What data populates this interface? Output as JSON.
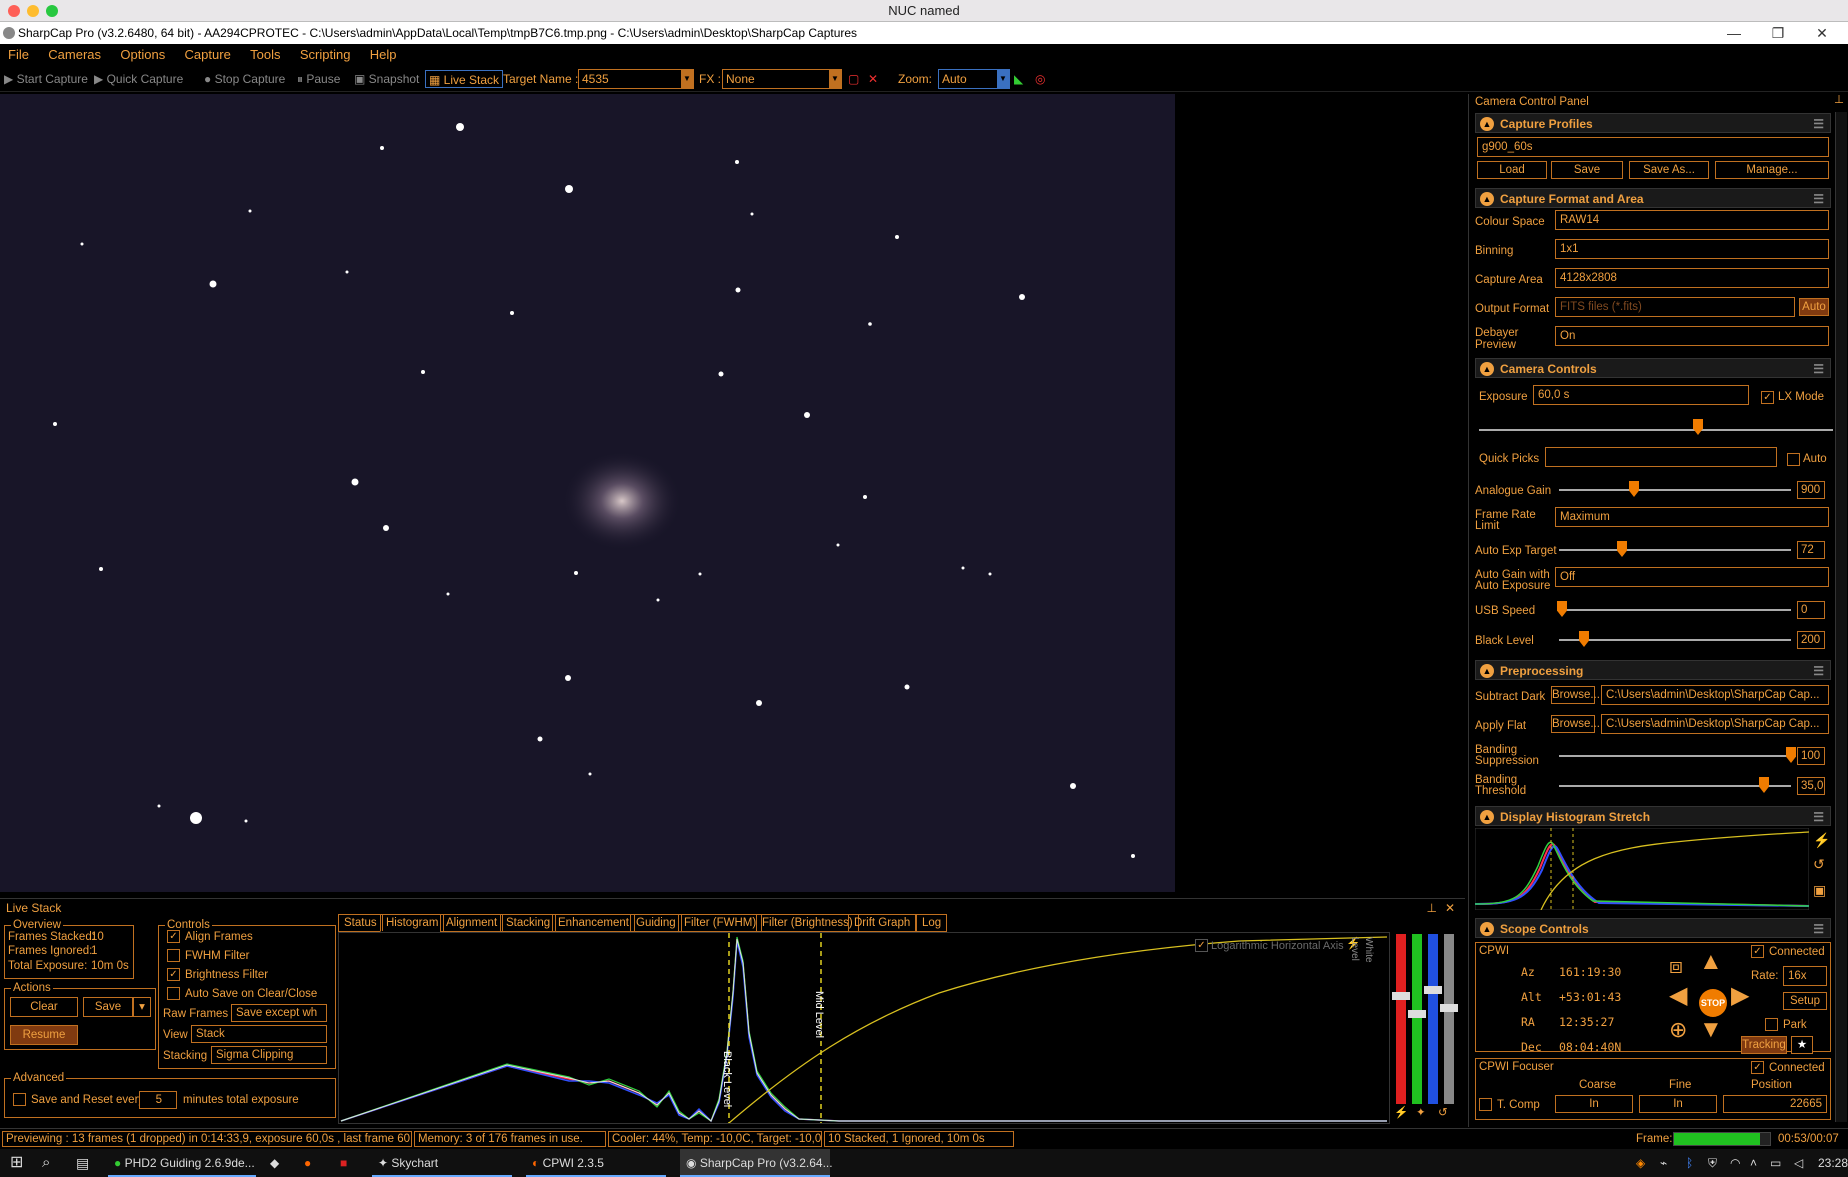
{
  "mac_title": "NUC named",
  "window_title": "SharpCap Pro (v3.2.6480, 64 bit) - AA294CPROTEC - C:\\Users\\admin\\AppData\\Local\\Temp\\tmpB7C6.tmp.png - C:\\Users\\admin\\Desktop\\SharpCap Captures",
  "menu": [
    "File",
    "Cameras",
    "Options",
    "Capture",
    "Tools",
    "Scripting",
    "Help"
  ],
  "toolbar": {
    "start_capture": "Start Capture",
    "quick_capture": "Quick Capture",
    "stop_capture": "Stop Capture",
    "pause": "Pause",
    "snapshot": "Snapshot",
    "live_stack": "Live Stack",
    "target_name_label": "Target Name :",
    "target_name_value": "4535",
    "fx_label": "FX :",
    "fx_value": "None",
    "zoom_label": "Zoom:",
    "zoom_value": "Auto"
  },
  "ccp": {
    "title": "Camera Control Panel",
    "capture_profiles": {
      "title": "Capture Profiles",
      "profile": "g900_60s",
      "load": "Load",
      "save": "Save",
      "save_as": "Save As...",
      "manage": "Manage..."
    },
    "format": {
      "title": "Capture Format and Area",
      "colour_space_label": "Colour Space",
      "colour_space": "RAW14",
      "binning_label": "Binning",
      "binning": "1x1",
      "capture_area_label": "Capture Area",
      "capture_area": "4128x2808",
      "output_format_label": "Output Format",
      "output_format": "FITS files (*.fits)",
      "auto": "Auto",
      "debayer_label_1": "Debayer",
      "debayer_label_2": "Preview",
      "debayer": "On"
    },
    "camera_controls": {
      "title": "Camera Controls",
      "exposure_label": "Exposure",
      "exposure": "60,0 s",
      "lx_mode": "LX Mode",
      "quick_picks_label": "Quick Picks",
      "auto": "Auto",
      "analogue_gain_label": "Analogue Gain",
      "analogue_gain": "900",
      "frame_rate_label_1": "Frame Rate",
      "frame_rate_label_2": "Limit",
      "frame_rate": "Maximum",
      "auto_exp_target_label": "Auto Exp Target",
      "auto_exp_target": "72",
      "auto_gain_label_1": "Auto Gain with",
      "auto_gain_label_2": "Auto Exposure",
      "auto_gain": "Off",
      "usb_speed_label": "USB Speed",
      "usb_speed": "0",
      "black_level_label": "Black Level",
      "black_level": "200"
    },
    "preprocessing": {
      "title": "Preprocessing",
      "subtract_dark_label": "Subtract Dark",
      "browse": "Browse...",
      "dark_path": "C:\\Users\\admin\\Desktop\\SharpCap Cap...",
      "apply_flat_label": "Apply Flat",
      "flat_path": "C:\\Users\\admin\\Desktop\\SharpCap Cap...",
      "banding_supp_label_1": "Banding",
      "banding_supp_label_2": "Suppression",
      "banding_supp": "100",
      "banding_thr_label_1": "Banding",
      "banding_thr_label_2": "Threshold",
      "banding_thr": "35,0"
    },
    "histogram_stretch": {
      "title": "Display Histogram Stretch"
    },
    "scope": {
      "title": "Scope Controls",
      "name": "CPWI",
      "connected": "Connected",
      "az_label": "Az",
      "az": "161:19:30",
      "alt_label": "Alt",
      "alt": "+53:01:43",
      "ra_label": "RA",
      "ra": "12:35:27",
      "dec_label": "Dec",
      "dec": "08:04:40N",
      "rate_label": "Rate:",
      "rate": "16x",
      "setup": "Setup",
      "park": "Park",
      "tracking": "Tracking",
      "stop": "STOP",
      "focuser": "CPWI Focuser",
      "focuser_connected": "Connected",
      "coarse": "Coarse",
      "fine": "Fine",
      "position": "Position",
      "t_comp": "T. Comp",
      "in_coarse": "In",
      "in_fine": "In",
      "position_value": "22665"
    }
  },
  "live_stack": {
    "title": "Live Stack",
    "overview": {
      "title": "Overview",
      "frames_stacked": "Frames Stacked:",
      "frames_stacked_v": "10",
      "frames_ignored": "Frames Ignored:",
      "frames_ignored_v": "1",
      "total_exposure": "Total Exposure:",
      "total_exposure_v": "10m 0s"
    },
    "actions": {
      "title": "Actions",
      "clear": "Clear",
      "save": "Save",
      "resume": "Resume"
    },
    "controls": {
      "title": "Controls",
      "align_frames": "Align Frames",
      "fwhm_filter": "FWHM Filter",
      "brightness_filter": "Brightness Filter",
      "auto_save": "Auto Save on Clear/Close",
      "raw_frames_label": "Raw Frames",
      "raw_frames": "Save except wh",
      "view_label": "View",
      "view": "Stack",
      "stacking_label": "Stacking",
      "stacking": "Sigma Clipping"
    },
    "advanced": {
      "title": "Advanced",
      "save_reset": "Save and Reset every",
      "minutes": "5",
      "minutes_label": "minutes total exposure"
    },
    "tabs": [
      "Status",
      "Histogram",
      "Alignment",
      "Stacking",
      "Enhancement",
      "Guiding",
      "Filter (FWHM)",
      "Filter (Brightness)",
      "Drift Graph",
      "Log"
    ],
    "hist": {
      "log_axis": "Logarithmic Horizontal Axis",
      "black_level": "Black Level",
      "mid_level": "Mid Level",
      "white_level": "White Level"
    }
  },
  "status": {
    "preview": "Previewing : 13 frames (1 dropped) in 0:14:33,9, exposure 60,0s , last frame 60,7s",
    "memory": "Memory: 3 of 176 frames in use.",
    "cooler": "Cooler: 44%, Temp: -10,0C, Target: -10,0C",
    "stacked": "10 Stacked, 1 Ignored, 10m 0s",
    "frame_label": "Frame:",
    "frame_time": "00:53/00:07",
    "frame_progress": 0.9
  },
  "taskbar": {
    "items": [
      "PHD2 Guiding 2.6.9de...",
      "Skychart",
      "CPWI 2.3.5",
      "SharpCap Pro (v3.2.64..."
    ],
    "time": "23:28"
  }
}
